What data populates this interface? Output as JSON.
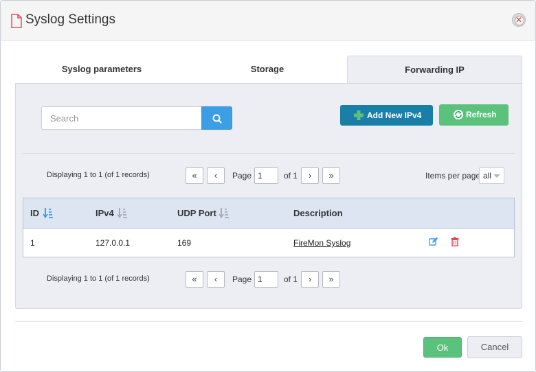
{
  "dialog": {
    "title": "Syslog Settings",
    "icons": {
      "title": "document-icon",
      "close": "close-icon"
    }
  },
  "tabs": [
    {
      "label": "Syslog parameters",
      "active": false
    },
    {
      "label": "Storage",
      "active": false
    },
    {
      "label": "Forwarding IP",
      "active": true
    }
  ],
  "toolbar": {
    "search_placeholder": "Search",
    "search_value": "",
    "add_label": "Add New IPv4",
    "refresh_label": "Refresh"
  },
  "pager": {
    "info": "Displaying 1 to 1 (of 1 records)",
    "page_label": "Page",
    "page_value": "1",
    "of_label": "of 1",
    "first": "«",
    "prev": "‹",
    "next": "›",
    "last": "»",
    "items_per_page_label": "Items per page",
    "items_per_page_value": "all"
  },
  "table": {
    "columns": [
      "ID",
      "IPv4",
      "UDP Port",
      "Description"
    ],
    "rows": [
      {
        "id": "1",
        "ipv4": "127.0.0.1",
        "udp_port": "169",
        "description": "FireMon Syslog"
      }
    ]
  },
  "footer": {
    "ok_label": "Ok",
    "cancel_label": "Cancel"
  },
  "colors": {
    "accent_blue": "#3d9ee8",
    "add_button": "#1a7fa8",
    "success_green": "#5bc27c",
    "delete_red": "#e0454e",
    "title_icon_red": "#e25563"
  }
}
